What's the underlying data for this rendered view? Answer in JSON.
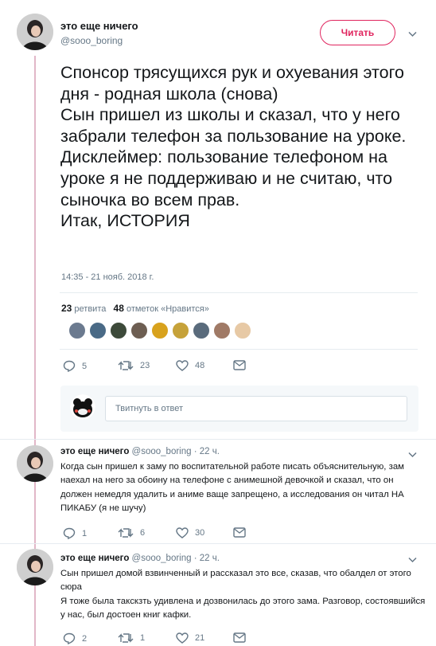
{
  "header": {
    "name": "это еще ничего",
    "handle": "@sooo_boring",
    "follow_label": "Читать"
  },
  "tweet": {
    "text": "Спонсор трясущихся рук и охуевания этого дня - родная школа (снова)\nСын пришел из школы и сказал, что у него забрали телефон за пользование на уроке.\nДисклеймер: пользование телефоном на уроке я не поддерживаю и не считаю, что сыночка во всем прав.\nИтак, ИСТОРИЯ",
    "timestamp": "14:35 - 21 нояб. 2018 г.",
    "retweets_count": "23",
    "retweets_label": "ретвита",
    "likes_count": "48",
    "likes_label": "отметок «Нравится»",
    "actions": {
      "replies": "5",
      "retweets": "23",
      "likes": "48"
    },
    "liker_colors": [
      "#6b7a8f",
      "#4a6a86",
      "#3d4a3a",
      "#6d5e52",
      "#d8a21d",
      "#c6a23a",
      "#5a6b7c",
      "#a07a66",
      "#e7c9a5"
    ]
  },
  "reply_box": {
    "placeholder": "Твитнуть в ответ"
  },
  "replies": [
    {
      "name": "это еще ничего",
      "handle": "@sooo_boring",
      "time": "22 ч.",
      "text": "Когда сын пришел к заму по воспитательной работе писать объяснительную, зам наехал на него за обоину на телефоне с анимешной девочкой и сказал, что он должен немедля удалить и аниме ваще запрещено, а исследования он читал НА ПИКАБУ (я не шучу)",
      "replies": "1",
      "retweets": "6",
      "likes": "30"
    },
    {
      "name": "это еще ничего",
      "handle": "@sooo_boring",
      "time": "22 ч.",
      "text": "Сын пришел домой взвинченный и рассказал это все, сказав, что обалдел от этого сюра\nЯ тоже была такскзть удивлена и дозвонилась до этого зама. Разговор, состоявшийся у нас, был достоен книг кафки.",
      "replies": "2",
      "retweets": "1",
      "likes": "21"
    }
  ],
  "colors": {
    "accent": "#e0245e",
    "thread_line": "#e1b7c8",
    "secondary_text": "#657786",
    "divider": "#e6ecf0"
  },
  "icons": [
    "chevron-down-icon",
    "reply-icon",
    "retweet-icon",
    "like-icon",
    "dm-icon"
  ]
}
